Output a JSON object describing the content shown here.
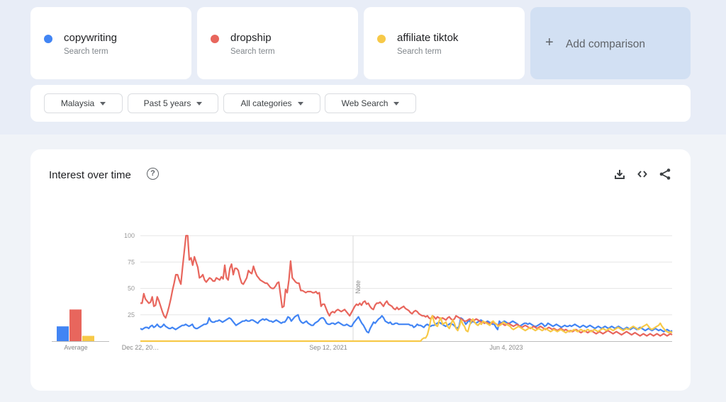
{
  "search_terms": [
    {
      "name": "copywriting",
      "subtitle": "Search term",
      "color": "#4285f4"
    },
    {
      "name": "dropship",
      "subtitle": "Search term",
      "color": "#e8665d"
    },
    {
      "name": "affiliate tiktok",
      "subtitle": "Search term",
      "color": "#f7c948"
    }
  ],
  "add_comparison": {
    "label": "Add comparison",
    "icon": "plus-icon"
  },
  "filters": [
    {
      "label": "Malaysia",
      "icon": "caret-down-icon"
    },
    {
      "label": "Past 5 years",
      "icon": "caret-down-icon"
    },
    {
      "label": "All categories",
      "icon": "caret-down-icon"
    },
    {
      "label": "Web Search",
      "icon": "caret-down-icon"
    }
  ],
  "interest_panel": {
    "title": "Interest over time",
    "help_icon": "help-circle-icon",
    "help_glyph": "?",
    "actions": [
      "download-icon",
      "embed-code-icon",
      "share-icon"
    ]
  },
  "chart_data": {
    "type": "line",
    "title": "Interest over time",
    "xlabel": "",
    "ylabel": "",
    "ylim": [
      0,
      100
    ],
    "y_ticks": [
      "100",
      "75",
      "50",
      "25"
    ],
    "x_tick_labels": [
      "Dec 22, 20…",
      "Sep 12, 2021",
      "Jun 4, 2023"
    ],
    "grid": true,
    "annotation": {
      "label": "Note",
      "position_fraction": 0.4
    },
    "average": {
      "label": "Average",
      "values": [
        {
          "name": "copywriting",
          "value": 14
        },
        {
          "name": "dropship",
          "value": 30
        },
        {
          "name": "affiliate tiktok",
          "value": 5
        }
      ]
    },
    "series": [
      {
        "name": "copywriting",
        "color": "#4285f4",
        "values": [
          12,
          11,
          12,
          13,
          13,
          12,
          14,
          15,
          13,
          14,
          16,
          14,
          13,
          14,
          16,
          14,
          13,
          12,
          12,
          13,
          12,
          11,
          12,
          13,
          14,
          15,
          15,
          16,
          15,
          14,
          15,
          16,
          13,
          12,
          12,
          13,
          14,
          15,
          16,
          16,
          17,
          22,
          19,
          18,
          18,
          19,
          19,
          20,
          19,
          18,
          19,
          20,
          21,
          22,
          21,
          19,
          17,
          15,
          16,
          17,
          18,
          19,
          19,
          20,
          19,
          19,
          20,
          20,
          19,
          18,
          17,
          19,
          20,
          21,
          20,
          21,
          20,
          19,
          19,
          18,
          19,
          20,
          19,
          18,
          17,
          18,
          18,
          20,
          23,
          22,
          19,
          21,
          23,
          24,
          25,
          20,
          18,
          17,
          18,
          19,
          17,
          16,
          15,
          15,
          17,
          18,
          19,
          21,
          22,
          22,
          20,
          17,
          16,
          16,
          17,
          17,
          16,
          17,
          18,
          17,
          16,
          15,
          15,
          16,
          15,
          14,
          14,
          17,
          19,
          21,
          23,
          20,
          17,
          15,
          12,
          9,
          8,
          12,
          15,
          18,
          17,
          19,
          21,
          22,
          24,
          22,
          19,
          18,
          17,
          18,
          16,
          16,
          17,
          17,
          16,
          16,
          16,
          16,
          16,
          16,
          16,
          15,
          15,
          13,
          14,
          16,
          15,
          15,
          14,
          13,
          15,
          16,
          15,
          14,
          15,
          15,
          16,
          17,
          18,
          17,
          16,
          15,
          14,
          15,
          16,
          17,
          16,
          15,
          13,
          12,
          14,
          22,
          21,
          19,
          16,
          18,
          20,
          17,
          19,
          18,
          17,
          18,
          19,
          20,
          19,
          17,
          18,
          19,
          18,
          17,
          16,
          16,
          13,
          11,
          19,
          17,
          18,
          19,
          18,
          17,
          17,
          18,
          19,
          18,
          17,
          16,
          14,
          15,
          16,
          17,
          17,
          16,
          17,
          16,
          15,
          14,
          14,
          15,
          16,
          17,
          16,
          14,
          15,
          17,
          16,
          15,
          14,
          15,
          16,
          15,
          14,
          13,
          14,
          15,
          14,
          14,
          15,
          14
        ],
        "values_tail": [
          15,
          16,
          15,
          14,
          13,
          14,
          15,
          14,
          13,
          14,
          15,
          14,
          13,
          12,
          13,
          14,
          13,
          12,
          13,
          14,
          13,
          12,
          13,
          14,
          13,
          12,
          13,
          14,
          13,
          12,
          11,
          12,
          13,
          12,
          11,
          12,
          13,
          12,
          11,
          12,
          13,
          12,
          11,
          10,
          11,
          12,
          11,
          10,
          11,
          12,
          11,
          10,
          11,
          10,
          9,
          10,
          11,
          10,
          9,
          10
        ]
      },
      {
        "name": "dropship",
        "color": "#e8665d",
        "values": [
          36,
          36,
          45,
          40,
          38,
          36,
          37,
          42,
          33,
          34,
          42,
          38,
          33,
          28,
          24,
          22,
          27,
          33,
          40,
          48,
          55,
          63,
          63,
          58,
          54,
          70,
          85,
          100,
          100,
          77,
          79,
          72,
          80,
          75,
          70,
          60,
          61,
          63,
          58,
          56,
          58,
          60,
          59,
          57,
          57,
          60,
          59,
          58,
          61,
          59,
          72,
          60,
          58,
          69,
          73,
          63,
          69,
          69,
          67,
          60,
          55,
          54,
          57,
          60,
          67,
          65,
          64,
          71,
          66,
          62,
          60,
          58,
          57,
          56,
          55,
          55,
          53,
          51,
          50,
          50,
          52,
          55,
          56,
          44,
          32,
          33,
          49,
          46,
          58,
          76,
          60,
          58,
          56,
          55,
          55,
          48,
          48,
          47,
          46,
          47,
          47,
          47,
          46,
          46,
          47,
          45,
          46,
          33,
          35,
          35,
          31,
          27,
          24,
          27,
          28,
          27,
          29,
          30,
          29,
          28,
          29,
          30,
          28,
          26,
          24,
          27,
          30,
          33,
          35,
          34,
          36,
          34,
          37,
          38,
          35,
          36,
          33,
          31,
          30,
          34,
          36,
          36,
          37,
          35,
          33,
          36,
          38,
          35,
          34,
          33,
          31,
          30,
          32,
          30,
          31,
          32,
          33,
          31,
          30,
          29,
          27,
          26,
          28,
          29,
          28,
          26,
          25,
          24,
          24,
          23,
          24,
          22,
          21,
          24,
          23,
          21,
          23,
          22,
          21,
          22,
          21,
          20,
          22,
          23,
          21,
          20,
          21,
          24,
          23,
          22,
          21,
          20,
          19,
          19,
          20,
          21,
          20,
          19,
          20,
          21,
          20,
          19,
          18,
          18,
          17,
          18,
          17,
          16,
          17,
          18,
          17,
          16,
          15,
          16,
          17,
          16,
          15,
          16,
          17,
          16,
          15,
          14,
          15,
          16,
          15,
          14,
          13,
          14,
          15,
          14,
          13,
          12,
          13,
          14,
          13,
          12,
          13,
          14,
          13,
          12,
          11,
          12,
          13,
          12,
          11,
          12,
          11,
          10,
          11,
          12,
          11,
          10,
          11,
          10,
          9,
          10
        ],
        "values_tail": [
          9,
          10,
          11,
          10,
          9,
          8,
          9,
          10,
          9,
          8,
          9,
          10,
          9,
          8,
          7,
          8,
          9,
          8,
          7,
          8,
          9,
          10,
          9,
          8,
          7,
          8,
          9,
          8,
          7,
          6,
          7,
          8,
          9,
          8,
          7,
          6,
          7,
          8,
          7,
          6,
          5,
          6,
          7,
          6,
          5,
          6,
          7,
          6,
          5,
          6,
          7,
          6,
          5,
          6,
          7,
          6,
          5,
          6,
          7,
          6
        ]
      },
      {
        "name": "affiliate tiktok",
        "color": "#f7c948",
        "values": [
          0,
          0,
          0,
          0,
          0,
          0,
          0,
          0,
          0,
          0,
          0,
          0,
          0,
          0,
          0,
          0,
          0,
          0,
          0,
          0,
          0,
          0,
          0,
          0,
          0,
          0,
          0,
          0,
          0,
          0,
          0,
          0,
          0,
          0,
          0,
          0,
          0,
          0,
          0,
          0,
          0,
          0,
          0,
          0,
          0,
          0,
          0,
          0,
          0,
          0,
          0,
          0,
          0,
          0,
          0,
          0,
          0,
          0,
          0,
          0,
          0,
          0,
          0,
          0,
          0,
          0,
          0,
          0,
          0,
          0,
          0,
          0,
          0,
          0,
          0,
          0,
          0,
          0,
          0,
          0,
          0,
          0,
          0,
          0,
          0,
          0,
          0,
          0,
          0,
          0,
          0,
          0,
          0,
          0,
          0,
          0,
          0,
          0,
          0,
          0,
          0,
          0,
          0,
          0,
          0,
          0,
          0,
          0,
          0,
          0,
          0,
          0,
          0,
          0,
          0,
          0,
          0,
          0,
          0,
          0,
          0,
          0,
          0,
          0,
          0,
          0,
          0,
          0,
          0,
          0,
          0,
          0,
          0,
          0,
          0,
          0,
          0,
          0,
          0,
          0,
          0,
          0,
          0,
          0,
          0,
          0,
          0,
          0,
          0,
          0,
          0,
          0,
          0,
          0,
          0,
          0,
          0,
          0,
          0,
          0,
          0,
          0,
          0,
          0,
          0,
          0,
          0,
          2,
          3,
          3,
          6,
          12,
          20,
          24,
          18,
          15,
          14,
          19,
          22,
          16,
          17,
          18,
          14,
          12,
          16,
          20,
          17,
          12,
          10,
          14,
          20,
          16,
          14,
          10,
          9,
          15,
          19,
          21,
          18,
          16,
          15,
          17,
          16,
          19,
          18,
          17,
          16,
          15,
          18,
          19,
          17,
          16,
          14,
          15,
          16,
          18,
          17,
          16,
          15,
          14,
          12,
          11,
          12,
          13,
          14,
          13,
          12,
          11,
          10,
          11,
          12,
          13,
          12,
          11,
          10,
          11,
          12,
          11,
          10,
          11,
          12,
          11,
          10,
          9,
          10,
          11,
          10,
          9,
          10,
          11,
          10,
          9,
          8,
          9,
          10,
          9
        ],
        "values_tail": [
          10,
          11,
          10,
          9,
          10,
          11,
          10,
          9,
          10,
          11,
          10,
          9,
          10,
          11,
          10,
          9,
          10,
          11,
          12,
          11,
          10,
          11,
          12,
          11,
          10,
          11,
          12,
          13,
          12,
          11,
          10,
          11,
          12,
          11,
          12,
          13,
          14,
          13,
          12,
          11,
          12,
          13,
          14,
          15,
          16,
          14,
          12,
          11,
          12,
          13,
          14,
          15,
          17,
          14,
          12,
          10,
          9,
          8,
          9,
          8
        ]
      }
    ]
  }
}
